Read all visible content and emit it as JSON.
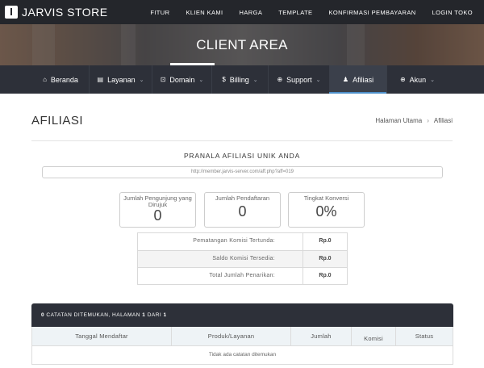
{
  "topbar": {
    "brand": "JARVIS STORE",
    "links": [
      "FITUR",
      "KLIEN KAMI",
      "HARGA",
      "TEMPLATE",
      "KONFIRMASI PEMBAYARAN",
      "LOGIN TOKO"
    ]
  },
  "hero": {
    "title": "CLIENT AREA"
  },
  "nav": {
    "items": [
      {
        "label": "Beranda",
        "icon": "home-icon",
        "glyph": "⌂",
        "chevron": false
      },
      {
        "label": "Layanan",
        "icon": "box-icon",
        "glyph": "▤",
        "chevron": true
      },
      {
        "label": "Domain",
        "icon": "binoculars-icon",
        "glyph": "⊡",
        "chevron": true
      },
      {
        "label": "Billing",
        "icon": "dollar-icon",
        "glyph": "$",
        "chevron": true
      },
      {
        "label": "Support",
        "icon": "globe-icon",
        "glyph": "⊕",
        "chevron": true
      },
      {
        "label": "Afiliasi",
        "icon": "user-icon",
        "glyph": "♟",
        "chevron": false
      },
      {
        "label": "Akun",
        "icon": "globe-icon",
        "glyph": "⊕",
        "chevron": true
      }
    ],
    "active": "Afiliasi",
    "accent": "#4d8fc9"
  },
  "page": {
    "title": "AFILIASI",
    "breadcrumb": [
      "Halaman Utama",
      "Afiliasi"
    ]
  },
  "affiliate": {
    "heading": "PRANALA AFILIASI UNIK ANDA",
    "link": "http://member.jarvis-server.com/aff.php?aff=019",
    "stats": [
      {
        "label": "Jumlah Pengunjung yang Dirujuk",
        "value": "0"
      },
      {
        "label": "Jumlah Pendaftaran",
        "value": "0"
      },
      {
        "label": "Tingkat Konversi",
        "value": "0%"
      }
    ],
    "commissions": [
      {
        "label": "Pematangan Komisi Tertunda:",
        "value": "Rp.0"
      },
      {
        "label": "Saldo Komisi Tersedia:",
        "value": "Rp.0"
      },
      {
        "label": "Total Jumlah Penarikan:",
        "value": "Rp.0"
      }
    ]
  },
  "records": {
    "summary_count": "0",
    "summary_text_1": " CATATAN DITEMUKAN, HALAMAN ",
    "summary_page": "1",
    "summary_text_2": " DARI ",
    "summary_total": "1",
    "columns": [
      "Tanggal Mendaftar",
      "Produk/Layanan",
      "Jumlah",
      "Komisi",
      "Status"
    ],
    "empty_text": "Tidak ada catatan ditemukan"
  }
}
